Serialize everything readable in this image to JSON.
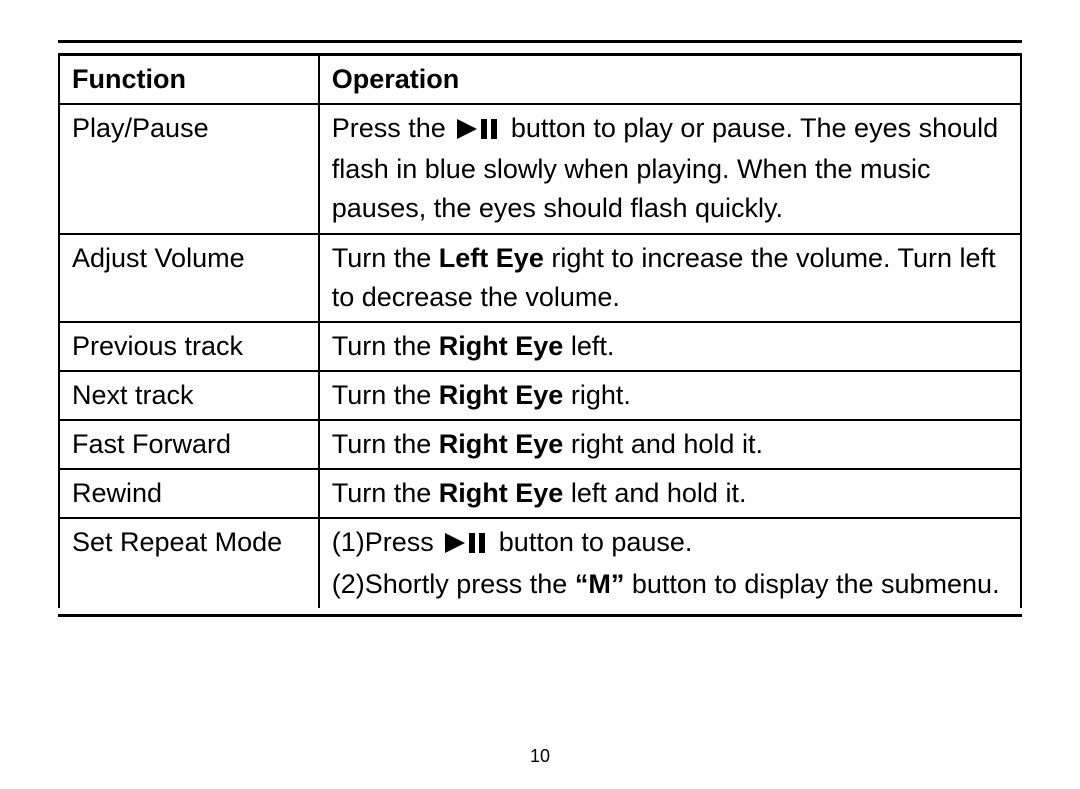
{
  "page_number": "10",
  "headers": {
    "function": "Function",
    "operation": "Operation"
  },
  "rows": {
    "play_pause": {
      "func": "Play/Pause",
      "op_before": "Press the ",
      "op_after": " button to play or pause. The eyes should flash in blue slowly when playing. When the music pauses, the eyes should flash quickly."
    },
    "adjust_volume": {
      "func": "Adjust Volume",
      "op_a": "Turn the ",
      "op_bold1": "Left Eye",
      "op_b": " right to increase the volume. Turn left to decrease the volume."
    },
    "previous_track": {
      "func": "Previous track",
      "op_a": "Turn the ",
      "op_bold1": "Right Eye",
      "op_b": " left."
    },
    "next_track": {
      "func": "Next track",
      "op_a": "Turn the ",
      "op_bold1": "Right Eye",
      "op_b": " right."
    },
    "fast_forward": {
      "func": "Fast Forward",
      "op_a": "Turn the ",
      "op_bold1": "Right Eye",
      "op_b": " right and hold it."
    },
    "rewind": {
      "func": "Rewind",
      "op_a": "Turn the ",
      "op_bold1": "Right Eye",
      "op_b": " left and hold it."
    },
    "set_repeat": {
      "func": "Set Repeat Mode",
      "op_line1_before": "(1)Press ",
      "op_line1_after": " button to pause.",
      "op_line2_before": "(2)Shortly press the ",
      "op_line2_bold": "“M”",
      "op_line2_after": " button to display the submenu."
    }
  },
  "icons": {
    "play_pause": "play-pause-icon"
  }
}
